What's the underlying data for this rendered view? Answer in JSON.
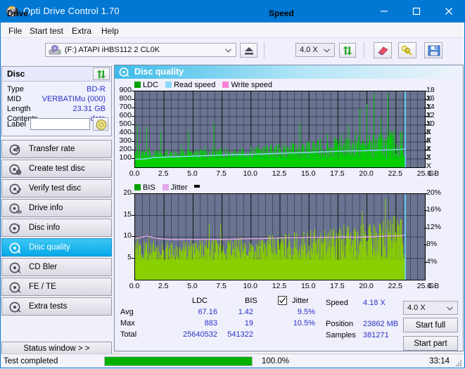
{
  "window": {
    "title": "Opti Drive Control 1.70",
    "icon": "disc-icon",
    "minimize": "minimize-icon",
    "maximize": "maximize-icon",
    "close": "close-icon",
    "accent": "#0078d4"
  },
  "menu": {
    "items": [
      "File",
      "Start test",
      "Extra",
      "Help"
    ]
  },
  "toolbar": {
    "drive_label": "Drive",
    "drive_value": "(F:)  ATAPI iHBS112  2 CL0K",
    "eject_icon": "eject-icon",
    "speed_label": "Speed",
    "speed_value": "4.0 X",
    "refresh_icon": "refresh-icon",
    "erase_icon": "eraser-icon",
    "bookmark_icon": "keys-icon",
    "save_icon": "floppy-save-icon"
  },
  "disc_panel": {
    "header": "Disc",
    "refresh_icon": "refresh-disc-icon",
    "rows": [
      {
        "label": "Type",
        "value": "BD-R"
      },
      {
        "label": "MID",
        "value": "VERBATIMu (000)"
      },
      {
        "label": "Length",
        "value": "23.31 GB"
      },
      {
        "label": "Contents",
        "value": "data"
      }
    ],
    "label_field": "Label",
    "label_value": "",
    "label_placeholder": "",
    "disc_icon": "cd-disc-icon"
  },
  "nav": {
    "items": [
      {
        "label": "Transfer rate",
        "icon": "disc-bolt-icon",
        "selected": false
      },
      {
        "label": "Create test disc",
        "icon": "disc-burn-icon",
        "selected": false
      },
      {
        "label": "Verify test disc",
        "icon": "disc-check-icon",
        "selected": false
      },
      {
        "label": "Drive info",
        "icon": "drive-info-icon",
        "selected": false
      },
      {
        "label": "Disc info",
        "icon": "disc-info-icon",
        "selected": false
      },
      {
        "label": "Disc quality",
        "icon": "disc-quality-icon",
        "selected": true
      },
      {
        "label": "CD Bler",
        "icon": "disc-bler-icon",
        "selected": false
      },
      {
        "label": "FE / TE",
        "icon": "disc-fete-icon",
        "selected": false
      },
      {
        "label": "Extra tests",
        "icon": "disc-extra-icon",
        "selected": false
      }
    ],
    "status_window": "Status window > >"
  },
  "content": {
    "title": "Disc quality",
    "title_icon": "disc-quality-icon"
  },
  "chart_data": [
    {
      "type": "area",
      "id": "ldc-chart",
      "title": "",
      "xlabel": "GB",
      "ylabel": "",
      "xlim": [
        0,
        25.0
      ],
      "xticks": [
        "0.0",
        "2.5",
        "5.0",
        "7.5",
        "10.0",
        "12.5",
        "15.0",
        "17.5",
        "20.0",
        "22.5",
        "25.0"
      ],
      "x_unit": "GB",
      "ylim": [
        0,
        900
      ],
      "yticks": [
        100,
        200,
        300,
        400,
        500,
        600,
        700,
        800,
        900
      ],
      "y2lim": [
        0,
        18
      ],
      "y2ticks": [
        "2 X",
        "4 X",
        "6 X",
        "8 X",
        "10 X",
        "12 X",
        "14 X",
        "16 X",
        "18 X"
      ],
      "grid": true,
      "legend_position": "top-left",
      "legend": [
        {
          "name": "LDC",
          "color": "#00c000"
        },
        {
          "name": "Read speed",
          "color": "#8fd8f5"
        },
        {
          "name": "Write speed",
          "color": "#ff7fd4"
        }
      ],
      "data_end_gb": 23.31,
      "series": [
        {
          "name": "LDC",
          "color": "#00c000",
          "x": [
            0.0,
            0.2,
            0.4,
            0.6,
            0.8,
            1.0,
            1.2,
            1.4,
            1.6,
            1.8,
            2.0,
            2.2,
            2.4,
            2.6,
            2.8,
            3.0,
            3.2,
            3.4,
            3.6,
            3.8,
            4.0,
            4.2,
            4.4,
            4.6,
            4.8,
            5.0,
            5.2,
            5.4,
            5.6,
            5.8,
            6.0,
            6.2,
            6.4,
            6.6,
            6.8,
            7.0,
            7.2,
            7.4,
            7.6,
            7.8,
            8.0,
            8.2,
            8.4,
            8.6,
            8.8,
            9.0,
            9.2,
            9.4,
            9.6,
            9.8,
            10.0,
            10.2,
            10.4,
            10.6,
            10.8,
            11.0,
            11.2,
            11.4,
            11.6,
            11.8,
            12.0,
            12.2,
            12.4,
            12.6,
            12.8,
            13.0,
            13.2,
            13.4,
            13.6,
            13.8,
            14.0,
            14.2,
            14.4,
            14.6,
            14.8,
            15.0,
            15.2,
            15.4,
            15.6,
            15.8,
            16.0,
            16.2,
            16.4,
            16.6,
            16.8,
            17.0,
            17.2,
            17.4,
            17.6,
            17.8,
            18.0,
            18.2,
            18.4,
            18.6,
            18.8,
            19.0,
            19.2,
            19.4,
            19.6,
            19.8,
            20.0,
            20.2,
            20.4,
            20.6,
            20.8,
            21.0,
            21.2,
            21.4,
            21.6,
            21.8,
            22.0,
            22.2,
            22.4,
            22.6,
            22.8,
            23.0,
            23.2,
            23.31
          ],
          "values": [
            140,
            500,
            250,
            180,
            150,
            480,
            230,
            160,
            140,
            130,
            120,
            430,
            150,
            130,
            120,
            125,
            115,
            130,
            120,
            140,
            260,
            145,
            130,
            440,
            150,
            130,
            125,
            135,
            120,
            130,
            240,
            135,
            125,
            130,
            530,
            170,
            140,
            135,
            130,
            230,
            140,
            130,
            125,
            210,
            135,
            130,
            240,
            140,
            130,
            135,
            250,
            140,
            135,
            210,
            145,
            135,
            140,
            260,
            150,
            140,
            150,
            280,
            160,
            150,
            290,
            165,
            155,
            160,
            300,
            175,
            165,
            520,
            185,
            175,
            180,
            310,
            190,
            300,
            200,
            190,
            340,
            210,
            200,
            390,
            230,
            210,
            370,
            240,
            230,
            400,
            250,
            240,
            500,
            260,
            250,
            430,
            270,
            700,
            290,
            280,
            750,
            320,
            300,
            870,
            340,
            320,
            600,
            350,
            330,
            880,
            420,
            390,
            430
          ]
        },
        {
          "name": "Read speed",
          "color": "#8fd8f5",
          "x": [
            0.0,
            1.0,
            1.5,
            2.5,
            3.5,
            4.5,
            5.5,
            6.5,
            7.5,
            8.5,
            9.5,
            10.5,
            11.5,
            12.5,
            13.5,
            14.5,
            15.5,
            16.5,
            17.5,
            18.5,
            19.5,
            20.5,
            21.5,
            22.5,
            23.31
          ],
          "values_x_speed": [
            1.9,
            2.0,
            2.3,
            2.4,
            2.5,
            2.6,
            2.7,
            2.8,
            2.9,
            3.0,
            3.0,
            3.1,
            3.2,
            3.3,
            3.4,
            3.5,
            3.6,
            3.7,
            3.8,
            3.9,
            3.9,
            4.0,
            4.1,
            4.2,
            4.3
          ]
        }
      ],
      "end_marker": {
        "color": "#5fd8ff",
        "x": 23.31
      }
    },
    {
      "type": "area",
      "id": "bis-chart",
      "title": "",
      "xlabel": "GB",
      "xlim": [
        0,
        25.0
      ],
      "xticks": [
        "0.0",
        "2.5",
        "5.0",
        "7.5",
        "10.0",
        "12.5",
        "15.0",
        "17.5",
        "20.0",
        "22.5",
        "25.0"
      ],
      "x_unit": "GB",
      "ylim": [
        0,
        20
      ],
      "yticks": [
        5,
        10,
        15,
        20
      ],
      "y2lim": [
        0,
        20
      ],
      "y2ticks": [
        "4%",
        "8%",
        "12%",
        "16%",
        "20%"
      ],
      "grid": true,
      "legend_position": "top-left",
      "legend": [
        {
          "name": "BIS",
          "color": "#00c000"
        },
        {
          "name": "Jitter",
          "color": "#e3a8e8"
        }
      ],
      "data_end_gb": 23.31,
      "series": [
        {
          "name": "BIS",
          "color": "#8ad000",
          "x": [
            0.0,
            0.2,
            0.4,
            0.6,
            0.8,
            1.0,
            1.2,
            1.4,
            1.6,
            1.8,
            2.0,
            2.2,
            2.4,
            2.6,
            2.8,
            3.0,
            3.2,
            3.4,
            3.6,
            3.8,
            4.0,
            4.2,
            4.4,
            4.6,
            4.8,
            5.0,
            5.2,
            5.4,
            5.6,
            5.8,
            6.0,
            6.2,
            6.4,
            6.6,
            6.8,
            7.0,
            7.2,
            7.4,
            7.6,
            7.8,
            8.0,
            8.2,
            8.4,
            8.6,
            8.8,
            9.0,
            9.2,
            9.4,
            9.6,
            9.8,
            10.0,
            10.2,
            10.4,
            10.6,
            10.8,
            11.0,
            11.2,
            11.4,
            11.6,
            11.8,
            12.0,
            12.2,
            12.4,
            12.6,
            12.8,
            13.0,
            13.2,
            13.4,
            13.6,
            13.8,
            14.0,
            14.2,
            14.4,
            14.6,
            14.8,
            15.0,
            15.2,
            15.4,
            15.6,
            15.8,
            16.0,
            16.2,
            16.4,
            16.6,
            16.8,
            17.0,
            17.2,
            17.4,
            17.6,
            17.8,
            18.0,
            18.2,
            18.4,
            18.6,
            18.8,
            19.0,
            19.2,
            19.4,
            19.6,
            19.8,
            20.0,
            20.2,
            20.4,
            20.6,
            20.8,
            21.0,
            21.2,
            21.4,
            21.6,
            21.8,
            22.0,
            22.2,
            22.4,
            22.6,
            22.8,
            23.0,
            23.2,
            23.31
          ],
          "values": [
            7,
            10,
            8,
            6,
            9,
            7,
            10,
            6,
            9,
            5,
            8,
            6,
            7,
            5,
            6,
            8,
            5,
            6,
            5,
            7,
            6,
            5,
            7,
            5,
            6,
            5,
            6,
            7,
            5,
            6,
            5,
            7,
            13,
            6,
            5,
            7,
            6,
            13,
            8,
            6,
            5,
            7,
            6,
            5,
            7,
            6,
            5,
            8,
            6,
            5,
            7,
            6,
            5,
            8,
            6,
            5,
            7,
            9,
            6,
            5,
            8,
            6,
            5,
            10,
            7,
            6,
            8,
            6,
            5,
            9,
            7,
            6,
            10,
            7,
            6,
            8,
            7,
            6,
            9,
            7,
            6,
            10,
            8,
            7,
            9,
            8,
            7,
            11,
            8,
            7,
            10,
            8,
            7,
            11,
            9,
            8,
            11,
            9,
            16,
            10,
            9,
            13,
            10,
            13,
            11,
            10,
            12,
            11,
            19,
            12,
            11,
            13,
            11,
            10
          ]
        },
        {
          "name": "Jitter",
          "color": "#e3a8e8",
          "x": [
            0.0,
            1.0,
            2.0,
            3.0,
            4.0,
            5.0,
            6.0,
            7.0,
            8.0,
            9.0,
            10.0,
            11.0,
            12.0,
            13.0,
            14.0,
            15.0,
            16.0,
            17.0,
            18.0,
            19.0,
            20.0,
            21.0,
            22.0,
            23.0,
            23.31
          ],
          "values_pct": [
            9.6,
            10.2,
            9.6,
            9.4,
            9.4,
            9.4,
            9.4,
            9.4,
            9.4,
            9.5,
            9.6,
            9.6,
            9.7,
            9.8,
            9.8,
            9.9,
            9.9,
            9.9,
            10.0,
            9.9,
            10.0,
            10.1,
            10.2,
            10.3,
            10.3
          ]
        }
      ],
      "end_marker": {
        "color": "#5fd8ff",
        "x": 23.31
      }
    }
  ],
  "stats": {
    "col_ldc": "LDC",
    "col_bis": "BIS",
    "jitter_label": "Jitter",
    "jitter_checked": true,
    "rows": [
      {
        "label": "Avg",
        "ldc": "67.16",
        "bis": "1.42",
        "jitter": "9.5%"
      },
      {
        "label": "Max",
        "ldc": "883",
        "bis": "19",
        "jitter": "10.5%"
      },
      {
        "label": "Total",
        "ldc": "25640532",
        "bis": "541322",
        "jitter": ""
      }
    ],
    "speed_label": "Speed",
    "speed_value": "4.18 X",
    "position_label": "Position",
    "position_value": "23862 MB",
    "samples_label": "Samples",
    "samples_value": "381271",
    "result_speed": "4.0 X",
    "start_full": "Start full",
    "start_part": "Start part"
  },
  "statusbar": {
    "message": "Test completed",
    "progress_pct": 100.0,
    "progress_text": "100.0%",
    "elapsed": "33:14"
  }
}
